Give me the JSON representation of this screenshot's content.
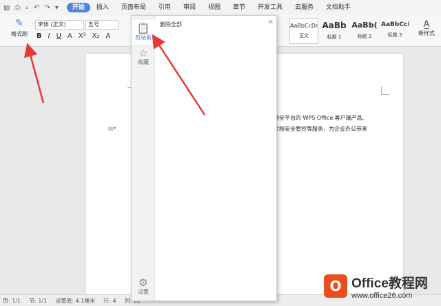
{
  "quick_access": [
    "▤",
    "⎙",
    "⌕",
    "↶",
    "↷",
    "▾"
  ],
  "menu": [
    "开始",
    "插入",
    "页面布局",
    "引用",
    "审阅",
    "视图",
    "章节",
    "开发工具",
    "云服务",
    "文档助手"
  ],
  "ribbon": {
    "format_painter": "格式刷",
    "font_name": "宋体 (正文)",
    "font_size": "五号",
    "format_buttons": [
      "B",
      "I",
      "U",
      "A",
      "X²",
      "X₂",
      "A"
    ],
    "styles": [
      {
        "preview": "AaBbCcDd",
        "name": "正文"
      },
      {
        "preview": "AaBb",
        "name": "标题 1"
      },
      {
        "preview": "AaBb(",
        "name": "标题 2"
      },
      {
        "preview": "AaBbCcI",
        "name": "标题 3"
      }
    ],
    "new_style": "新样式"
  },
  "document": {
    "line1": "跨全平台的 WPS Office 客户端产品,",
    "line2": "文档安全管控等服务，为企业办公带来"
  },
  "clipboard_panel": {
    "tabs": [
      {
        "icon": "clipboard-icon",
        "label": "剪贴板"
      },
      {
        "icon": "star-icon",
        "label": "收藏"
      }
    ],
    "clear_all": "删除全部",
    "settings": "设置",
    "close": "×"
  },
  "statusbar": [
    "页: 1/1",
    "节: 1/1",
    "设置值: 4.1厘米",
    "行: 4",
    "列: 22"
  ],
  "watermark": {
    "brand": "Office教程网",
    "url": "www.office26.com"
  },
  "colors": {
    "accent": "#4a87d8",
    "arrow": "#e53935",
    "logo": "#e94e1b"
  }
}
